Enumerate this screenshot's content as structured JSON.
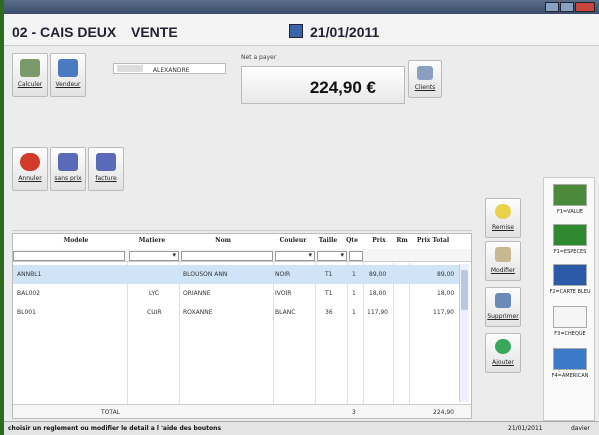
{
  "window": {
    "title": ""
  },
  "header": {
    "caisse": "02 - CAIS DEUX",
    "mode": "VENTE",
    "date": "21/01/2011"
  },
  "toolbar": {
    "calcul_label": "Calculer",
    "vendeur_label": "Vendeur",
    "annuler_label": "Annuler",
    "sans_prix_label": "sans prix",
    "facture_label": "facture"
  },
  "vendeur": {
    "name": "ALEXANDRE"
  },
  "net": {
    "label": "Net a payer",
    "value": "224,90 €"
  },
  "clients": {
    "label": "Clients"
  },
  "grid": {
    "columns": [
      "Modele",
      "Matiere",
      "Nom",
      "Couleur",
      "Taille",
      "Qte",
      "Prix",
      "Rm",
      "Prix Total"
    ],
    "rows": [
      {
        "modele": "ANNBL1",
        "matiere": "",
        "nom": "BLOUSON ANN",
        "couleur": "NOIR",
        "taille": "T1",
        "qte": "1",
        "prix": "89,00",
        "rm": "",
        "total": "89,00"
      },
      {
        "modele": "BAL002",
        "matiere": "LYC",
        "nom": "ORIANNE",
        "couleur": "IVOIR",
        "taille": "T1",
        "qte": "1",
        "prix": "18,00",
        "rm": "",
        "total": "18,00"
      },
      {
        "modele": "BL001",
        "matiere": "CUIR",
        "nom": "ROXANNE",
        "couleur": "BLANC",
        "taille": "36",
        "qte": "1",
        "prix": "117,90",
        "rm": "",
        "total": "117,90"
      }
    ],
    "total_label": "TOTAL",
    "total_qte": "3",
    "total_value": "224,90"
  },
  "actions": {
    "remise_label": "Remise",
    "modifier_label": "Modifier",
    "supprimer_label": "Supprimer",
    "ajouter_label": "Ajouter"
  },
  "payments": [
    {
      "label": "F1=VALUE",
      "color": "#4a8a3a"
    },
    {
      "label": "F1=ESPECES",
      "color": "#2f8a2f"
    },
    {
      "label": "F2=CARTE BLEU",
      "color": "#2a5aa8"
    },
    {
      "label": "F3=CHEQUE",
      "color": "#f5f5f5"
    },
    {
      "label": "F4=AMERICAN",
      "color": "#3a7ac8"
    }
  ],
  "status": {
    "message": "choisir un reglement ou modifier le detail a l 'aide des boutons",
    "date": "21/01/2011",
    "user": "davier"
  }
}
